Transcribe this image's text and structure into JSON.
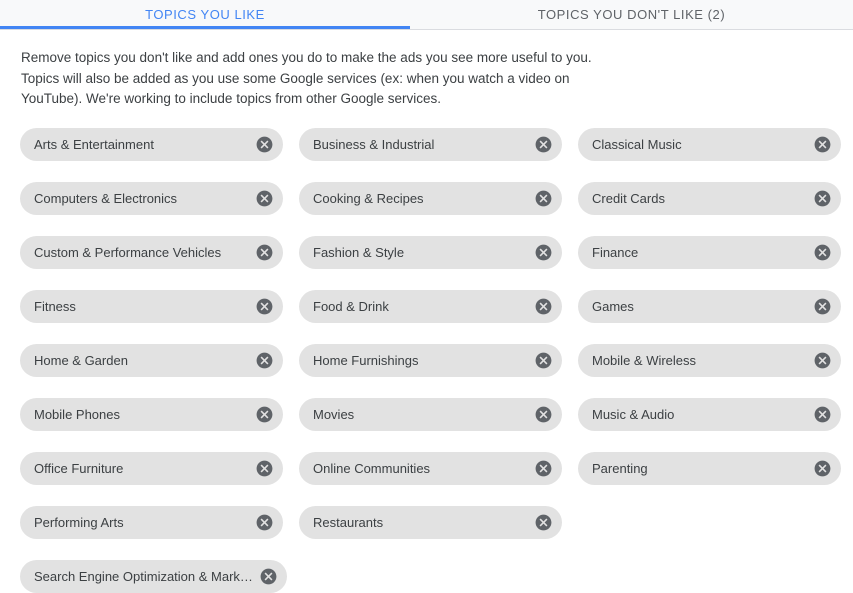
{
  "tabs": [
    {
      "label": "TOPICS YOU LIKE",
      "active": true
    },
    {
      "label": "TOPICS YOU DON'T LIKE (2)",
      "active": false
    }
  ],
  "description": "Remove topics you don't like and add ones you do to make the ads you see more useful to you. Topics will also be added as you use some Google services (ex: when you watch a video on YouTube). We're working to include topics from other Google services.",
  "remove_icon": "close-circle-icon",
  "colors": {
    "accent": "#4285f4",
    "tabbar_background": "#f8f9fa",
    "tabbar_border": "#dadce0",
    "chip_background": "#e2e2e2",
    "chip_text": "#3c4043",
    "remove_icon_fill": "#5f6368",
    "inactive_tab_text": "#5f6368"
  },
  "topics": [
    {
      "label": "Arts & Entertainment"
    },
    {
      "label": "Business & Industrial"
    },
    {
      "label": "Classical Music"
    },
    {
      "label": "Computers & Electronics"
    },
    {
      "label": "Cooking & Recipes"
    },
    {
      "label": "Credit Cards"
    },
    {
      "label": "Custom & Performance Vehicles"
    },
    {
      "label": "Fashion & Style"
    },
    {
      "label": "Finance"
    },
    {
      "label": "Fitness"
    },
    {
      "label": "Food & Drink"
    },
    {
      "label": "Games"
    },
    {
      "label": "Home & Garden"
    },
    {
      "label": "Home Furnishings"
    },
    {
      "label": "Mobile & Wireless"
    },
    {
      "label": "Mobile Phones"
    },
    {
      "label": "Movies"
    },
    {
      "label": "Music & Audio"
    },
    {
      "label": "Office Furniture"
    },
    {
      "label": "Online Communities"
    },
    {
      "label": "Parenting"
    },
    {
      "label": "Performing Arts"
    },
    {
      "label": "Restaurants"
    },
    {
      "label": "Search Engine Optimization & Mark…"
    }
  ]
}
